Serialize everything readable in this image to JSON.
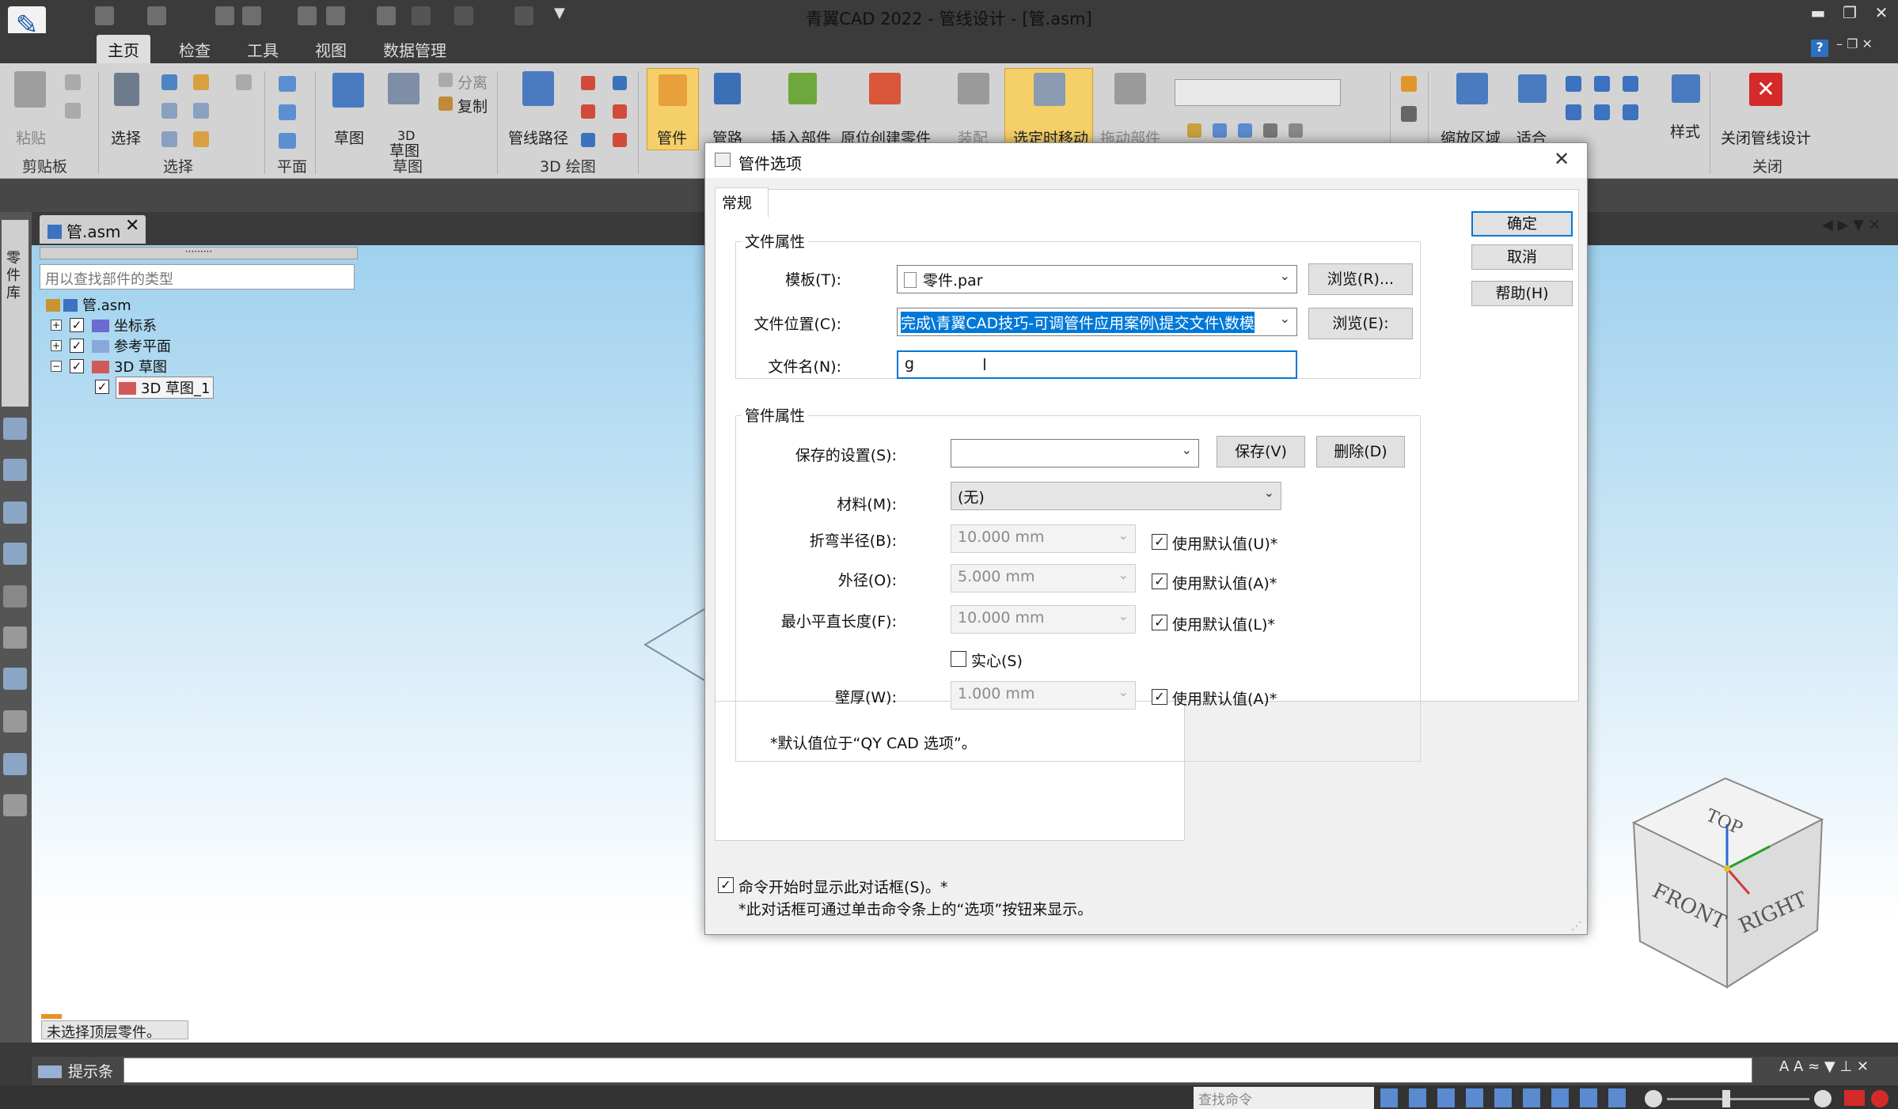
{
  "window": {
    "title": "青翼CAD 2022 - 管线设计 - [管.asm]"
  },
  "menu_tabs": [
    "主页",
    "检查",
    "工具",
    "视图",
    "数据管理"
  ],
  "ribbon": {
    "clipboard": {
      "paste": "粘贴",
      "group": "剪贴板"
    },
    "select": {
      "select": "选择",
      "group": "选择"
    },
    "plane": {
      "group": "平面"
    },
    "sketch": {
      "sketch": "草图",
      "sketch3d_top": "3D",
      "sketch3d_bottom": "草图",
      "group": "草图",
      "detach": "分离",
      "copy": "复制"
    },
    "draw3d": {
      "route": "管线路径",
      "group": "3D 绘图"
    },
    "pipe": {
      "fitting": "管件",
      "pipe": "管路",
      "insert": "插入部件",
      "create_in_place": "原位创建零件",
      "assemble": "装配",
      "move_on_select": "选定时移动",
      "drag": "拖动部件"
    },
    "view": {
      "zoom_area": "缩放区域",
      "fit": "适合"
    },
    "style": {
      "style": "样式"
    },
    "close": {
      "close_pipe": "关闭管线设计",
      "group": "关闭"
    }
  },
  "doc_tab": "管.asm",
  "doc_tab_close": "✕",
  "partfinder": {
    "placeholder": "用以查找部件的类型",
    "dots": "·········"
  },
  "tree": [
    {
      "label": "管.asm",
      "level": 0
    },
    {
      "label": "坐标系",
      "level": 1,
      "exp": "+"
    },
    {
      "label": "参考平面",
      "level": 1,
      "exp": "+"
    },
    {
      "label": "3D 草图",
      "level": 1,
      "exp": "−"
    },
    {
      "label": "3D 草图_1",
      "level": 2
    }
  ],
  "left_vertical_label": "零件库",
  "status_left": "未选择顶层零件。",
  "cmdbar": {
    "label": "提示条"
  },
  "statusbar": {
    "find_placeholder": "查找命令"
  },
  "dialog": {
    "title": "管件选项",
    "close": "✕",
    "tab": "常规",
    "file_group": "文件属性",
    "template_label": "模板(T):",
    "template_value": "零件.par",
    "browse_r": "浏览(R)...",
    "location_label": "文件位置(C):",
    "location_value": "完成\\青翼CAD技巧-可调管件应用案例\\提交文件\\数模",
    "browse_e": "浏览(E):",
    "filename_label": "文件名(N):",
    "filename_value": "g",
    "pipe_group": "管件属性",
    "saved_label": "保存的设置(S):",
    "saved_value": "",
    "save_btn": "保存(V)",
    "delete_btn": "删除(D)",
    "material_label": "材料(M):",
    "material_value": "(无)",
    "bend_label": "折弯半径(B):",
    "bend_value": "10.000 mm",
    "bend_default": "使用默认值(U)*",
    "od_label": "外径(O):",
    "od_value": "5.000 mm",
    "od_default": "使用默认值(A)*",
    "minlen_label": "最小平直长度(F):",
    "minlen_value": "10.000 mm",
    "minlen_default": "使用默认值(L)*",
    "solid_label": "实心(S)",
    "wall_label": "壁厚(W):",
    "wall_value": "1.000 mm",
    "wall_default": "使用默认值(A)*",
    "note": "*默认值位于“QY CAD 选项”。",
    "ok": "确定",
    "cancel": "取消",
    "help": "帮助(H)",
    "show_on_start": "命令开始时显示此对话框(S)。*",
    "footer_note": "*此对话框可通过单击命令条上的“选项”按钮来显示。"
  },
  "viewcube": {
    "top": "TOP",
    "front": "FRONT",
    "right": "RIGHT"
  },
  "colors": {
    "accent": "#0078d7",
    "ribbon_highlight": "#f5d069",
    "close_red": "#d42a2a"
  }
}
